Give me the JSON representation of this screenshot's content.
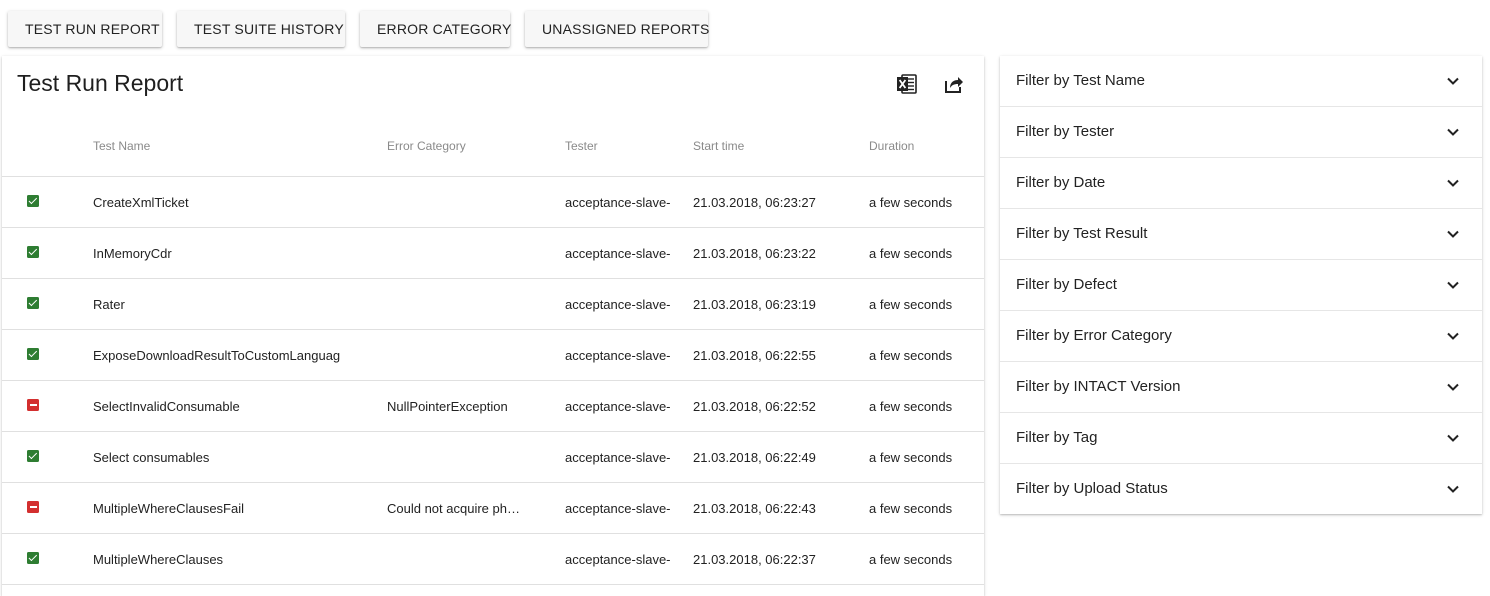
{
  "nav": {
    "buttons": [
      {
        "label": "TEST RUN REPORT"
      },
      {
        "label": "TEST SUITE HISTORY"
      },
      {
        "label": "ERROR CATEGORY"
      },
      {
        "label": "UNASSIGNED REPORTS"
      }
    ]
  },
  "report": {
    "title": "Test Run Report",
    "icons": {
      "export": "excel-icon",
      "share": "share-icon"
    },
    "columns": {
      "status": "",
      "name": "Test Name",
      "error": "Error Category",
      "tester": "Tester",
      "start": "Start time",
      "duration": "Duration"
    },
    "rows": [
      {
        "status": "pass",
        "name": "CreateXmlTicket",
        "error": "",
        "tester": "acceptance-slave-",
        "start": "21.03.2018, 06:23:27",
        "duration": "a few seconds"
      },
      {
        "status": "pass",
        "name": "InMemoryCdr",
        "error": "",
        "tester": "acceptance-slave-",
        "start": "21.03.2018, 06:23:22",
        "duration": "a few seconds"
      },
      {
        "status": "pass",
        "name": "Rater",
        "error": "",
        "tester": "acceptance-slave-",
        "start": "21.03.2018, 06:23:19",
        "duration": "a few seconds"
      },
      {
        "status": "pass",
        "name": "ExposeDownloadResultToCustomLanguag",
        "error": "",
        "tester": "acceptance-slave-",
        "start": "21.03.2018, 06:22:55",
        "duration": "a few seconds"
      },
      {
        "status": "fail",
        "name": "SelectInvalidConsumable",
        "error": "NullPointerException",
        "tester": "acceptance-slave-",
        "start": "21.03.2018, 06:22:52",
        "duration": "a few seconds"
      },
      {
        "status": "pass",
        "name": "Select consumables",
        "error": "",
        "tester": "acceptance-slave-",
        "start": "21.03.2018, 06:22:49",
        "duration": "a few seconds"
      },
      {
        "status": "fail",
        "name": "MultipleWhereClausesFail",
        "error": "Could not acquire ph…",
        "tester": "acceptance-slave-",
        "start": "21.03.2018, 06:22:43",
        "duration": "a few seconds"
      },
      {
        "status": "pass",
        "name": "MultipleWhereClauses",
        "error": "",
        "tester": "acceptance-slave-",
        "start": "21.03.2018, 06:22:37",
        "duration": "a few seconds"
      }
    ]
  },
  "filters": {
    "items": [
      {
        "label": "Filter by Test Name"
      },
      {
        "label": "Filter by Tester"
      },
      {
        "label": "Filter by Date"
      },
      {
        "label": "Filter by Test Result"
      },
      {
        "label": "Filter by Defect"
      },
      {
        "label": "Filter by Error Category"
      },
      {
        "label": "Filter by INTACT Version"
      },
      {
        "label": "Filter by Tag"
      },
      {
        "label": "Filter by Upload Status"
      }
    ]
  },
  "colors": {
    "pass": "#2e7d32",
    "fail": "#d32f2f"
  }
}
